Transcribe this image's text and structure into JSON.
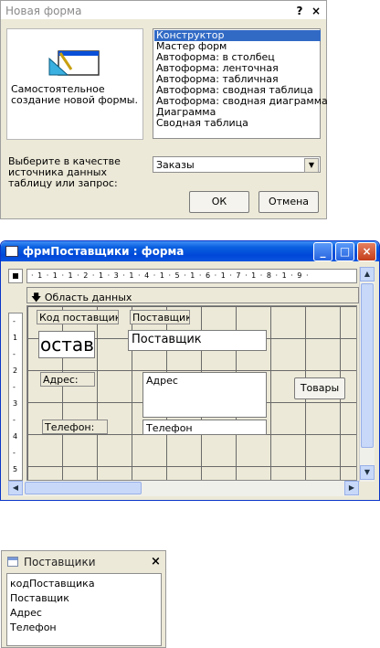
{
  "dialog": {
    "title": "Новая форма",
    "help_glyph": "?",
    "close_glyph": "×",
    "description": "Самостоятельное создание новой формы.",
    "options": [
      "Конструктор",
      "Мастер форм",
      "Автоформа: в столбец",
      "Автоформа: ленточная",
      "Автоформа: табличная",
      "Автоформа:  сводная таблица",
      "Автоформа:  сводная диаграмма",
      "Диаграмма",
      "Сводная таблица"
    ],
    "selected_option": "Конструктор",
    "source_label": "Выберите в качестве источника данных таблицу или запрос:",
    "source_value": "Заказы",
    "ok_label": "ОК",
    "cancel_label": "Отмена"
  },
  "form_window": {
    "title": "фрмПоставщики : форма",
    "section_label": "Область данных",
    "ruler_marks": "· 1 · 1 · 1 · 2 · 1 · 3 · 1 · 4 · 1 · 5 · 1 · 6 · 1 · 7 · 1 · 8 · 1 · 9 ·",
    "left_ruler": [
      "-",
      "1",
      "-",
      "2",
      "-",
      "3",
      "-",
      "4",
      "-",
      "5"
    ],
    "controls": {
      "code_label": "Код поставщика:",
      "code_field": "оставщ",
      "supplier_label": "Поставщик:",
      "supplier_field": "Поставщик",
      "address_label": "Адрес:",
      "address_field": "Адрес",
      "goods_button": "Товары",
      "phone_label": "Телефон:",
      "phone_field": "Телефон"
    }
  },
  "field_list": {
    "title": "Поставщики",
    "close_glyph": "×",
    "fields": [
      "кодПоставщика",
      "Поставщик",
      "Адрес",
      "Телефон"
    ]
  }
}
